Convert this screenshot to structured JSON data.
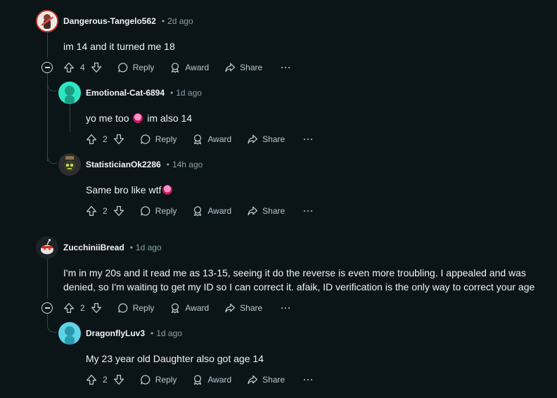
{
  "comments": [
    {
      "author": "Dangerous-Tangelo562",
      "time": "2d ago",
      "body": "im 14 and it turned me 18",
      "score": "4",
      "actions": {
        "reply": "Reply",
        "award": "Award",
        "share": "Share",
        "more": "···"
      }
    },
    {
      "author": "Emotional-Cat-6894",
      "time": "1d ago",
      "body_before": "yo me too",
      "body_after": "im also 14",
      "score": "2",
      "actions": {
        "reply": "Reply",
        "award": "Award",
        "share": "Share",
        "more": "···"
      }
    },
    {
      "author": "StatisticianOk2286",
      "time": "14h ago",
      "body": "Same bro like wtf",
      "score": "2",
      "actions": {
        "reply": "Reply",
        "award": "Award",
        "share": "Share",
        "more": "···"
      }
    },
    {
      "author": "ZucchiniiBread",
      "time": "1d ago",
      "body_line1": "I'm in my 20s and it read me as 13-15, seeing it do the reverse is even more troubling. I appealed and was",
      "body_line2": "denied, so I'm waiting to get my ID so I can correct it. afaik, ID verification is the only way to correct your age",
      "score": "2",
      "actions": {
        "reply": "Reply",
        "award": "Award",
        "share": "Share",
        "more": "···"
      }
    },
    {
      "author": "DragonflyLuv3",
      "time": "1d ago",
      "body": "My 23 year old Daughter also got age 14",
      "score": "2",
      "actions": {
        "reply": "Reply",
        "award": "Award",
        "share": "Share",
        "more": "···"
      }
    }
  ],
  "dot": "•",
  "colors": {
    "background": "#0b1416",
    "text": "#f2f4f5",
    "muted": "#8ba2ad",
    "time": "#8ba2ad"
  }
}
